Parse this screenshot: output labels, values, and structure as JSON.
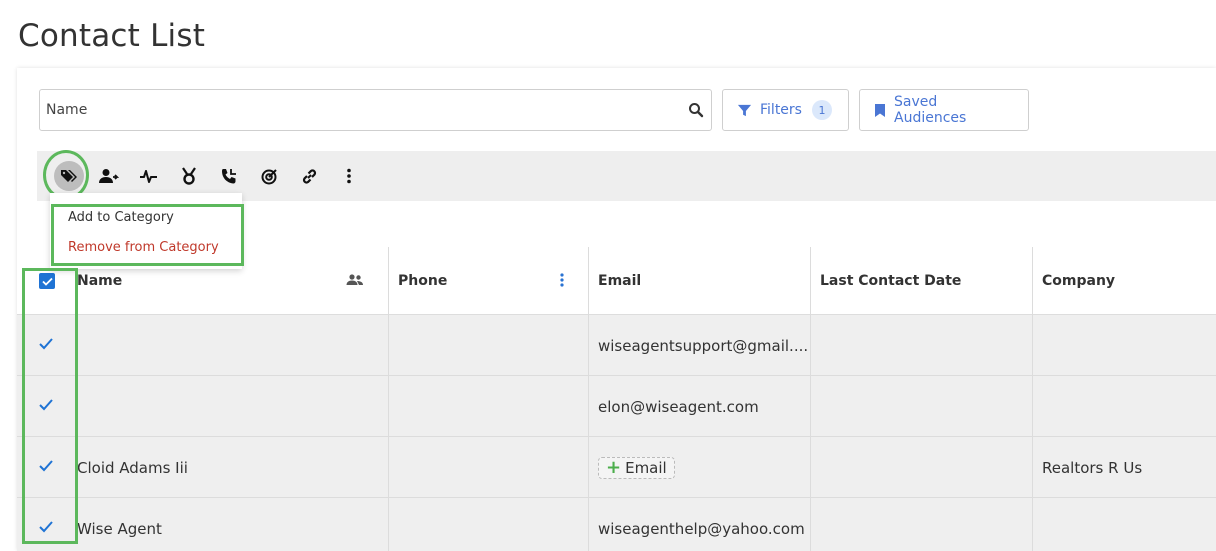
{
  "page": {
    "title": "Contact List"
  },
  "search": {
    "placeholder": "Name"
  },
  "filters": {
    "label": "Filters",
    "count": "1"
  },
  "saved_audiences": {
    "label": "Saved Audiences"
  },
  "toolbar": {
    "icons": [
      "tag-icon",
      "user-transfer-icon",
      "activity-icon",
      "medal-icon",
      "phone-call-icon",
      "target-icon",
      "link-icon",
      "more-vertical-icon"
    ]
  },
  "category_menu": {
    "add": "Add to Category",
    "remove": "Remove from Category"
  },
  "table": {
    "columns": [
      "Name",
      "Phone",
      "Email",
      "Last Contact Date",
      "Company"
    ],
    "rows": [
      {
        "name": "",
        "phone": "",
        "email": "wiseagentsupport@gmail....",
        "last_contact": "",
        "company": ""
      },
      {
        "name": "",
        "phone": "",
        "email": "elon@wiseagent.com",
        "last_contact": "",
        "company": ""
      },
      {
        "name": "Cloid Adams Iii",
        "phone": "",
        "email_action": "Email",
        "last_contact": "",
        "company": "Realtors R Us"
      },
      {
        "name": "Wise Agent",
        "phone": "",
        "email": "wiseagenthelp@yahoo.com",
        "last_contact": "",
        "company": ""
      }
    ]
  },
  "colors": {
    "accent": "#4a76d4",
    "checkbox": "#1f73d4",
    "highlight": "#5cb85c",
    "danger": "#c0392b"
  }
}
